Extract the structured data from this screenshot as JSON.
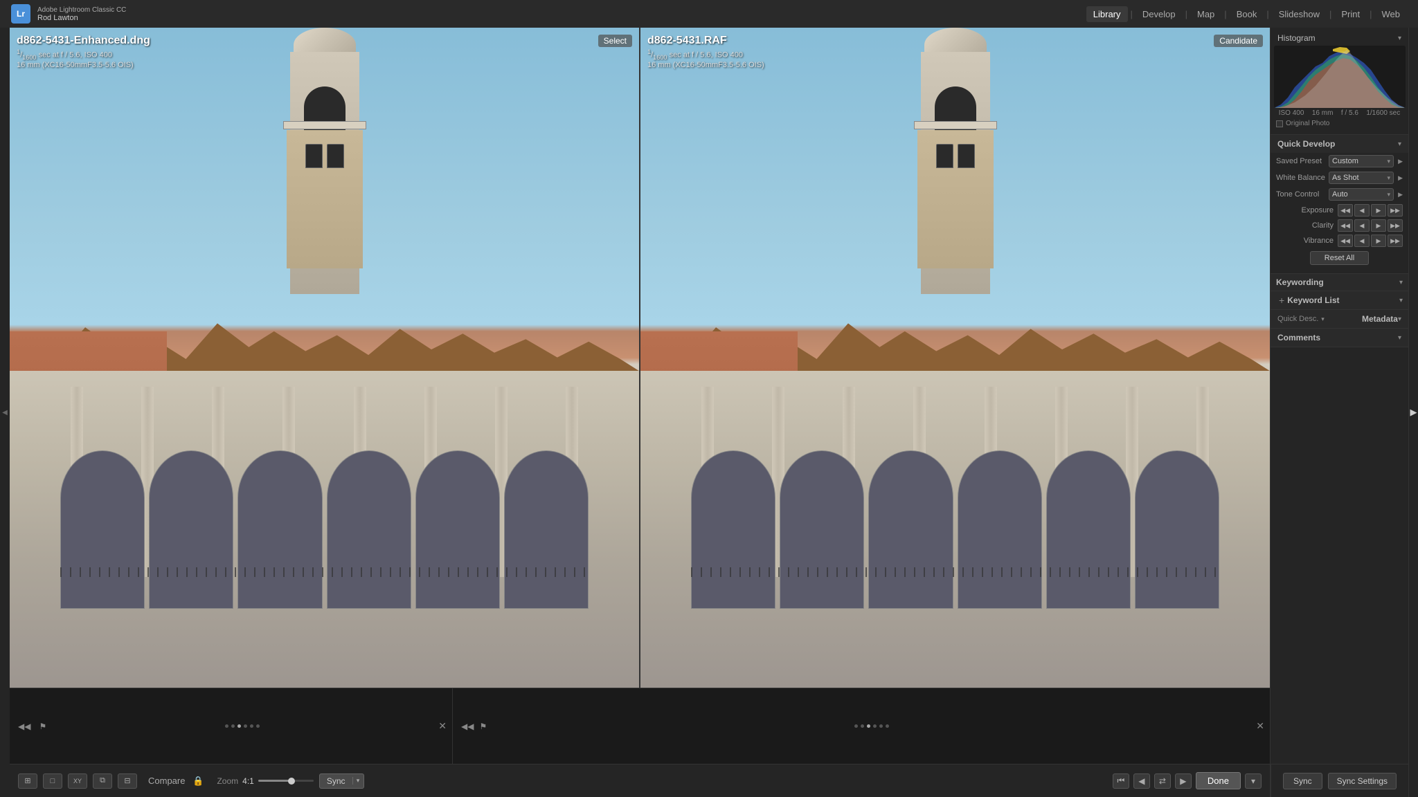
{
  "app": {
    "logo": "Lr",
    "title": "Adobe Lightroom Classic CC",
    "user": "Rod Lawton"
  },
  "nav": {
    "items": [
      {
        "label": "Library",
        "active": true
      },
      {
        "label": "Develop",
        "active": false
      },
      {
        "label": "Map",
        "active": false
      },
      {
        "label": "Book",
        "active": false
      },
      {
        "label": "Slideshow",
        "active": false
      },
      {
        "label": "Print",
        "active": false
      },
      {
        "label": "Web",
        "active": false
      }
    ]
  },
  "photo_left": {
    "badge": "Select",
    "filename": "d862-5431-Enhanced.dng",
    "shutter": "1/1600",
    "aperture": "f / 5.6",
    "iso": "ISO 400",
    "focal": "16 mm (XC16-50mmF3.5-5.6 OIS)"
  },
  "photo_right": {
    "badge": "Candidate",
    "filename": "d862-5431.RAF",
    "shutter": "1/1600",
    "aperture": "f / 5.6",
    "iso": "ISO 400",
    "focal": "16 mm (XC16-50mmF3.5-5.6 OIS)"
  },
  "histogram": {
    "title": "Histogram",
    "info": [
      "ISO 400",
      "16 mm",
      "f / 5.6",
      "1/1600 sec"
    ],
    "original_photo_label": "Original Photo"
  },
  "quick_develop": {
    "title": "Quick Develop",
    "saved_preset_label": "Saved Preset",
    "saved_preset_value": "Custom",
    "white_balance_label": "White Balance",
    "white_balance_value": "As Shot",
    "tone_control_label": "Tone Control",
    "tone_control_value": "Auto",
    "exposure_label": "Exposure",
    "clarity_label": "Clarity",
    "vibrance_label": "Vibrance",
    "reset_btn": "Reset All"
  },
  "keywording": {
    "title": "Keywording"
  },
  "keyword_list": {
    "title": "Keyword List"
  },
  "metadata": {
    "title": "Metadata",
    "quick_desc_label": "Quick Desc.",
    "quick_desc_value": ""
  },
  "comments": {
    "title": "Comments"
  },
  "bottom_toolbar": {
    "compare_label": "Compare",
    "zoom_label": "Zoom",
    "zoom_value": "4:1",
    "sync_label": "Sync",
    "done_label": "Done"
  },
  "sync_settings": {
    "sync_label": "Sync",
    "sync_settings_label": "Sync Settings"
  },
  "filmstrip": {
    "dots": [
      1,
      2,
      3,
      4,
      5,
      6
    ]
  }
}
